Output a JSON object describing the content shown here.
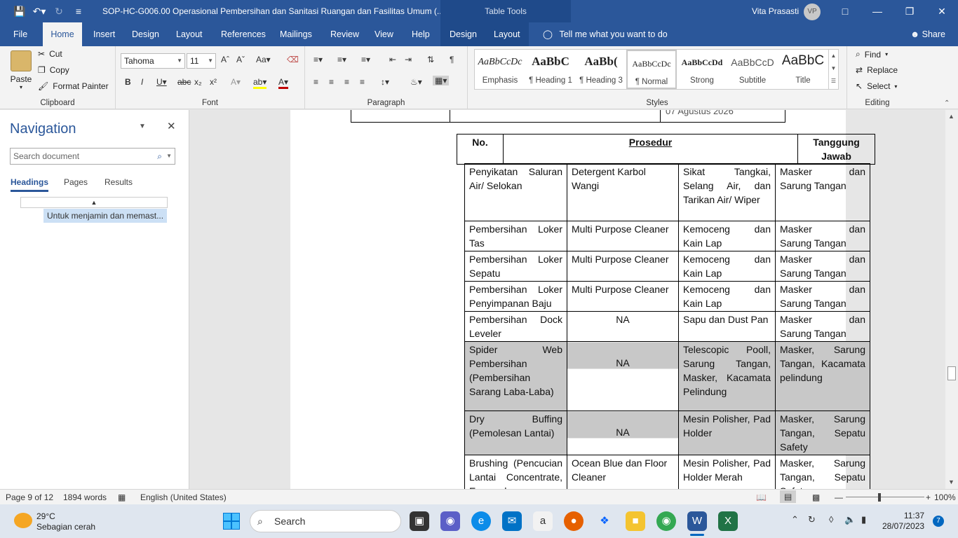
{
  "titlebar": {
    "doc_title": "SOP-HC-G006.00 Operasional Pembersihan dan Sanitasi Ruangan dan Fasilitas Umum (...",
    "context_label": "Table Tools",
    "user_name": "Vita Prasasti",
    "user_initials": "VP"
  },
  "tabs": [
    "File",
    "Home",
    "Insert",
    "Design",
    "Layout",
    "References",
    "Mailings",
    "Review",
    "View",
    "Help",
    "Design",
    "Layout"
  ],
  "tell_me": "Tell me what you want to do",
  "share": "Share",
  "clipboard": {
    "paste": "Paste",
    "cut": "Cut",
    "copy": "Copy",
    "format_painter": "Format Painter",
    "label": "Clipboard"
  },
  "font": {
    "name": "Tahoma",
    "size": "11",
    "label": "Font"
  },
  "paragraph": {
    "label": "Paragraph"
  },
  "styles": {
    "label": "Styles",
    "items": [
      {
        "sample": "AaBbCcDc",
        "name": "Emphasis"
      },
      {
        "sample": "AaBbC",
        "name": "¶ Heading 1"
      },
      {
        "sample": "AaBb(",
        "name": "¶ Heading 3"
      },
      {
        "sample": "AaBbCcDc",
        "name": "¶ Normal"
      },
      {
        "sample": "AaBbCcDd",
        "name": "Strong"
      },
      {
        "sample": "AaBbCcD",
        "name": "Subtitle"
      },
      {
        "sample": "AaBbC",
        "name": "Title"
      }
    ]
  },
  "editing": {
    "find": "Find",
    "replace": "Replace",
    "select": "Select",
    "label": "Editing"
  },
  "navigation": {
    "title": "Navigation",
    "search_placeholder": "Search document",
    "tabs": [
      "Headings",
      "Pages",
      "Results"
    ],
    "heading_item": "Untuk menjamin dan memast..."
  },
  "document": {
    "date_text": "07 Agustus 2026",
    "header": {
      "no": "No.",
      "prosedur": "Prosedur",
      "tanggung": "Tanggung Jawab"
    },
    "rows": [
      {
        "c1": "Penyikatan Saluran Air/ Selokan",
        "c2": "Detergent Karbol Wangi",
        "c3": "Sikat Tangkai, Selang Air, dan Tarikan Air/ Wiper",
        "c4": "Masker dan Sarung Tangan",
        "gray": false
      },
      {
        "c1": "Pembersihan Loker Tas",
        "c2": "Multi Purpose Cleaner",
        "c3": "Kemoceng dan Kain Lap",
        "c4": "Masker dan Sarung Tangan",
        "gray": false
      },
      {
        "c1": "Pembersihan Loker Sepatu",
        "c2": "Multi Purpose Cleaner",
        "c3": "Kemoceng dan Kain Lap",
        "c4": "Masker dan Sarung Tangan",
        "gray": false
      },
      {
        "c1": "Pembersihan Loker Penyimpanan Baju",
        "c2": "Multi Purpose Cleaner",
        "c3": "Kemoceng dan Kain Lap",
        "c4": "Masker dan Sarung Tangan",
        "gray": false
      },
      {
        "c1": "Pembersihan Dock Leveler",
        "c2": "NA",
        "c3": "Sapu dan Dust Pan",
        "c4": "Masker dan Sarung Tangan",
        "gray": false
      },
      {
        "c1": "Spider Web Pembersihan (Pembersihan Sarang Laba-Laba)",
        "c2": "NA",
        "c3": "Telescopic Pooll, Sarung Tangan, Masker, Kacamata Pelindung",
        "c4": "Masker, Sarung Tangan, Kacamata pelindung",
        "gray": true
      },
      {
        "c1": "Dry Buffing (Pemolesan Lantai)",
        "c2": "NA",
        "c3": "Mesin Polisher, Pad Holder",
        "c4": "Masker, Sarung Tangan, Sepatu Safety",
        "gray": true
      },
      {
        "c1": "Brushing (Pencucian Lantai Concentrate, Epoxy, dan",
        "c2": "Ocean Blue dan Floor Cleaner",
        "c3": "Mesin Polisher, Pad Holder Merah",
        "c4": "Masker, Sarung Tangan, Sepatu Safety",
        "gray": false
      }
    ]
  },
  "status": {
    "page": "Page 9 of 12",
    "words": "1894 words",
    "language": "English (United States)",
    "zoom": "100%"
  },
  "taskbar": {
    "temp": "29°C",
    "weather": "Sebagian cerah",
    "search": "Search",
    "time": "11:37",
    "date": "28/07/2023",
    "badge": "7"
  }
}
